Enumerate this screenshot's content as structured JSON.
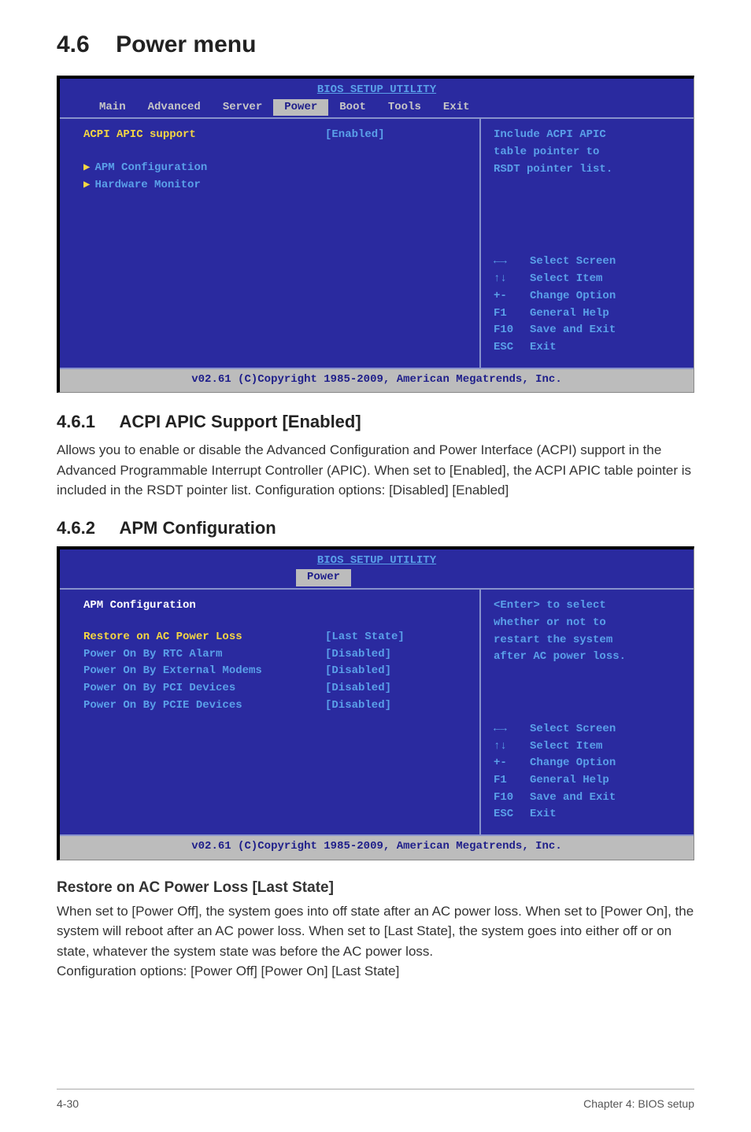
{
  "section_number": "4.6",
  "section_title": "Power menu",
  "bios1": {
    "title": "BIOS SETUP UTILITY",
    "tabs": [
      "Main",
      "Advanced",
      "Server",
      "Power",
      "Boot",
      "Tools",
      "Exit"
    ],
    "active_tab": "Power",
    "item_label": "ACPI APIC support",
    "item_value": "[Enabled]",
    "sub_items": [
      "APM Configuration",
      "Hardware Monitor"
    ],
    "help_lines": [
      "Include ACPI APIC",
      "table pointer to",
      "RSDT pointer list."
    ],
    "keys": [
      {
        "k": "←→",
        "v": "Select Screen"
      },
      {
        "k": "↑↓",
        "v": "Select Item"
      },
      {
        "k": "+-",
        "v": "Change Option"
      },
      {
        "k": "F1",
        "v": "General Help"
      },
      {
        "k": "F10",
        "v": "Save and Exit"
      },
      {
        "k": "ESC",
        "v": "Exit"
      }
    ],
    "footer": "v02.61 (C)Copyright 1985-2009, American Megatrends, Inc."
  },
  "sub461": {
    "heading_num": "4.6.1",
    "heading_text": "ACPI APIC Support [Enabled]",
    "body": "Allows you to enable or disable the Advanced Configuration and Power Interface (ACPI) support in the Advanced Programmable Interrupt Controller (APIC). When set to [Enabled], the ACPI APIC table pointer is included in the RSDT pointer list. Configuration options: [Disabled] [Enabled]"
  },
  "sub462": {
    "heading_num": "4.6.2",
    "heading_text": "APM Configuration"
  },
  "bios2": {
    "title": "BIOS SETUP UTILITY",
    "single_tab": "Power",
    "panel_title": "APM Configuration",
    "rows": [
      {
        "label": "Restore on AC Power Loss",
        "value": "[Last State]"
      },
      {
        "label": "Power On By RTC Alarm",
        "value": "[Disabled]"
      },
      {
        "label": "Power On By External Modems",
        "value": "[Disabled]"
      },
      {
        "label": "Power On By PCI Devices",
        "value": "[Disabled]"
      },
      {
        "label": "Power On By PCIE Devices",
        "value": "[Disabled]"
      }
    ],
    "help_lines": [
      "<Enter> to select",
      "whether or not to",
      "restart the system",
      "after AC power loss."
    ],
    "keys": [
      {
        "k": "←→",
        "v": "Select Screen"
      },
      {
        "k": "↑↓",
        "v": "Select Item"
      },
      {
        "k": "+-",
        "v": "Change Option"
      },
      {
        "k": "F1",
        "v": "General Help"
      },
      {
        "k": "F10",
        "v": "Save and Exit"
      },
      {
        "k": "ESC",
        "v": "Exit"
      }
    ],
    "footer": "v02.61 (C)Copyright 1985-2009, American Megatrends, Inc."
  },
  "restore_section": {
    "heading": "Restore on AC Power Loss [Last State]",
    "body1": "When set to [Power Off], the system goes into off state after an AC power loss. When set to [Power On], the system will reboot after an AC power loss. When set to [Last State], the system goes into either off or on state, whatever the system state was before the AC power loss.",
    "body2": "Configuration options: [Power Off] [Power On] [Last State]"
  },
  "page_footer": {
    "left": "4-30",
    "right": "Chapter 4: BIOS setup"
  }
}
